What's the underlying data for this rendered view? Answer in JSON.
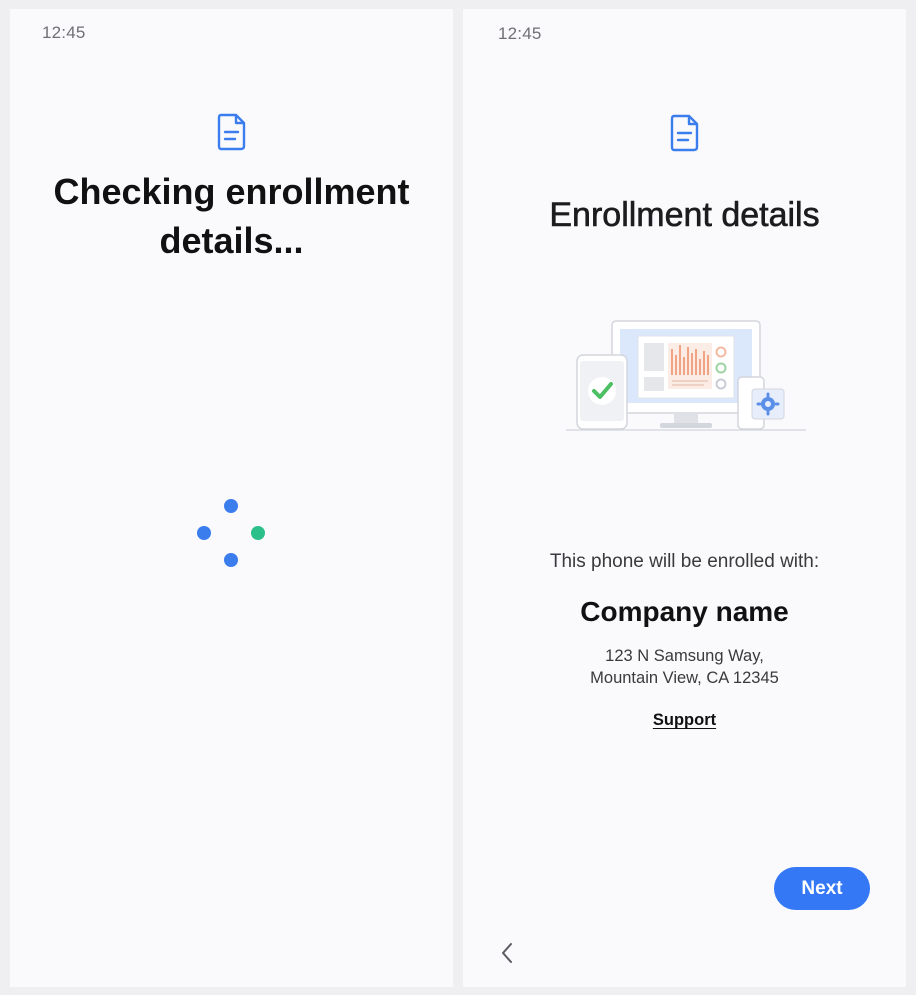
{
  "left_screen": {
    "status_time": "12:45",
    "title": "Checking enrollment details...",
    "icons": {
      "top": "document-icon",
      "loader": "loading-dots-icon"
    },
    "colors": {
      "dot_blue": "#3b7ded",
      "dot_green": "#2bbf8a",
      "icon": "#3b7ded"
    }
  },
  "right_screen": {
    "status_time": "12:45",
    "title": "Enrollment details",
    "enrolled_label": "This phone will be enrolled with:",
    "company_name": "Company name",
    "address_line1": "123 N Samsung Way,",
    "address_line2": "Mountain View, CA 12345",
    "support_label": "Support",
    "next_label": "Next",
    "icons": {
      "top": "document-icon",
      "back": "chevron-left-icon",
      "illustration": "devices-illustration"
    },
    "colors": {
      "accent": "#3478f6"
    }
  }
}
